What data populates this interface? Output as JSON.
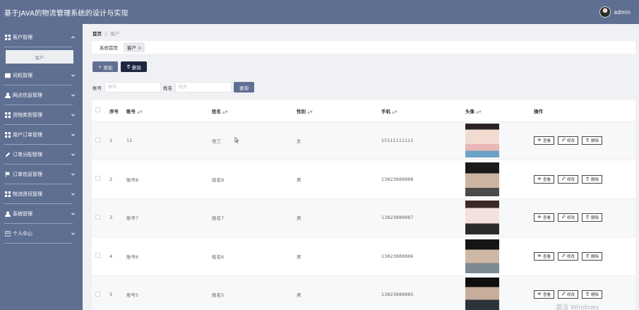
{
  "header": {
    "title": "基于JAVA的物流管理系统的设计与实现",
    "username": "admin"
  },
  "sidebar": {
    "groups": [
      {
        "label": "客户管理",
        "icon": "grid-icon",
        "expanded": true,
        "children": [
          {
            "label": "客户"
          }
        ]
      },
      {
        "label": "司机管理",
        "icon": "list-icon"
      },
      {
        "label": "网点信息管理",
        "icon": "user-icon"
      },
      {
        "label": "货物类型管理",
        "icon": "grid-icon"
      },
      {
        "label": "用户订单管理",
        "icon": "grid-icon"
      },
      {
        "label": "订单分配管理",
        "icon": "pen-icon"
      },
      {
        "label": "订单信息管理",
        "icon": "flag-icon"
      },
      {
        "label": "物流资讯管理",
        "icon": "grid-icon"
      },
      {
        "label": "系统管理",
        "icon": "user-icon"
      },
      {
        "label": "个人中心",
        "icon": "card-icon"
      }
    ]
  },
  "breadcrumb": {
    "home": "首页",
    "sep": "//",
    "current": "客户"
  },
  "tags": [
    {
      "label": "系统首页"
    },
    {
      "label": "客户",
      "close": "×"
    }
  ],
  "toolbar": {
    "add_label": "添加",
    "delete_label": "删除"
  },
  "search": {
    "account_label": "账号",
    "account_placeholder": "账号",
    "name_label": "姓名",
    "name_placeholder": "姓名",
    "query_label": "查询"
  },
  "table": {
    "columns": {
      "index": "序号",
      "account": "账号",
      "name": "姓名",
      "gender": "性别",
      "phone": "手机",
      "avatar": "头像",
      "actions": "操作"
    },
    "actions": {
      "view": "查看",
      "edit": "修改",
      "delete": "删除"
    },
    "rows": [
      {
        "index": "1",
        "account": "11",
        "name": "张三",
        "gender": "女",
        "phone": "15111111111"
      },
      {
        "index": "2",
        "account": "账号8",
        "name": "姓名8",
        "gender": "男",
        "phone": "13823888888"
      },
      {
        "index": "3",
        "account": "账号7",
        "name": "姓名7",
        "gender": "男",
        "phone": "13823888887"
      },
      {
        "index": "4",
        "account": "账号6",
        "name": "姓名6",
        "gender": "男",
        "phone": "13823888886"
      },
      {
        "index": "5",
        "account": "账号5",
        "name": "姓名5",
        "gender": "男",
        "phone": "13823888885"
      }
    ]
  },
  "watermark": "激活 Windows",
  "colors": {
    "primary": "#5f6f92",
    "dark_button": "#1e2740",
    "background": "#f0f1f4"
  }
}
